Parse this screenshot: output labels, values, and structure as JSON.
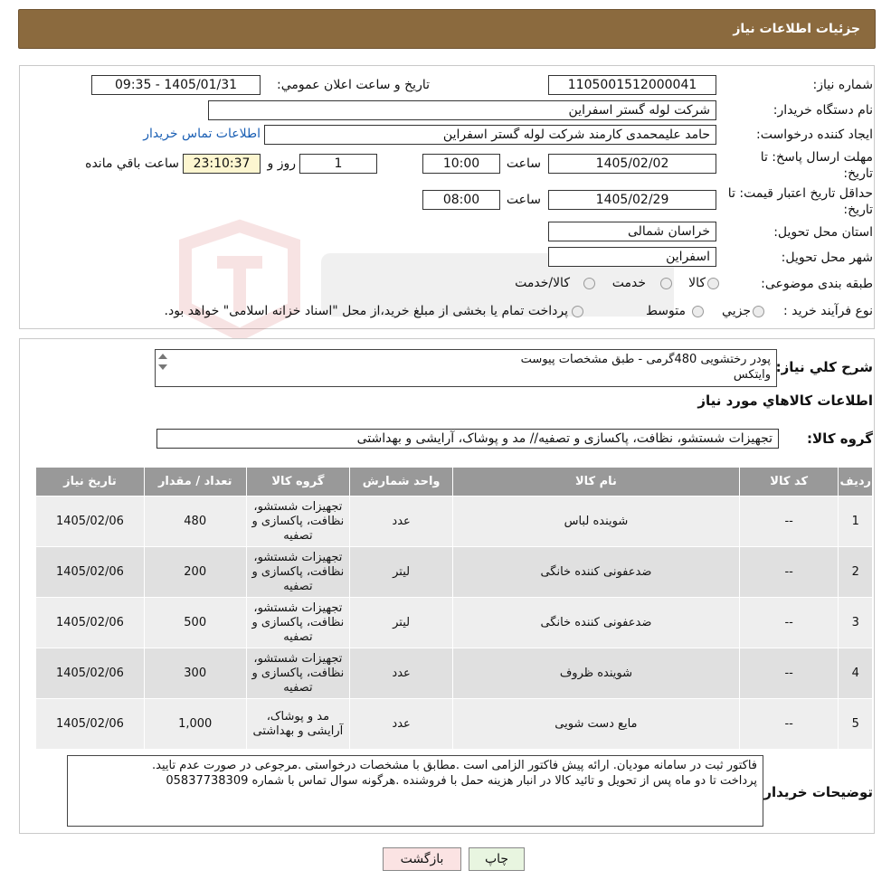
{
  "header": {
    "title": "جزئیات اطلاعات نیاز"
  },
  "info": {
    "need_number_label": "شماره نیاز:",
    "need_number": "1105001512000041",
    "announce_label": "تاریخ و ساعت اعلان عمومي:",
    "announce_value": "1405/01/31 - 09:35",
    "buyer_org_label": "نام دستگاه خریدار:",
    "buyer_org": "شرکت لوله گستر اسفراین",
    "creator_label": "ایجاد کننده درخواست:",
    "creator": "حامد علیمحمدی کارمند شرکت لوله گستر اسفراین",
    "contact_link": "اطلاعات تماس خریدار",
    "reply_deadline_label_1": "مهلت ارسال پاسخ: تا",
    "reply_deadline_label_2": "تاریخ:",
    "reply_date": "1405/02/02",
    "time_label": "ساعت",
    "reply_time": "10:00",
    "reply_days": "1",
    "days_label": "روز و",
    "remaining_time": "23:10:37",
    "remaining_label": "ساعت باقي مانده",
    "price_validity_label_1": "حداقل تاریخ اعتبار قیمت: تا",
    "price_validity_label_2": "تاریخ:",
    "price_date": "1405/02/29",
    "price_time": "08:00",
    "province_label": "استان محل تحویل:",
    "province": "خراسان شمالی",
    "city_label": "شهر محل تحویل:",
    "city": "اسفراین",
    "category_label": "طبقه بندی موضوعی:",
    "category_options": [
      "کالا",
      "خدمت",
      "کالا/خدمت"
    ],
    "process_label": "نوع فرآیند خرید :",
    "process_options": [
      "جزیي",
      "متوسط"
    ],
    "process_note": "پرداخت تمام یا بخشی از مبلغ خرید،از محل \"اسناد خزانه اسلامی\" خواهد بود."
  },
  "details": {
    "summary_label": "شرح کلي نیاز:",
    "summary_line1": "پودر رختشویی 480گرمی - طبق مشخصات پیوست",
    "summary_line2": "وایتکس",
    "goods_info_title": "اطلاعات کالاهاي مورد نیاز",
    "goods_group_label": "گروه کالا:",
    "goods_group": "تجهیزات شستشو، نظافت، پاکسازی و تصفیه// مد و پوشاک، آرایشی و بهداشتی"
  },
  "table": {
    "headers": [
      "ردیف",
      "کد کالا",
      "نام کالا",
      "واحد شمارش",
      "گروه کالا",
      "تعداد / مقدار",
      "تاریخ نیاز"
    ],
    "rows": [
      {
        "row": "1",
        "code": "--",
        "name": "شوینده لباس",
        "unit": "عدد",
        "group": "تجهیزات شستشو، نظافت، پاکسازی و تصفیه",
        "qty": "480",
        "date": "1405/02/06"
      },
      {
        "row": "2",
        "code": "--",
        "name": "ضدعفونی کننده خانگی",
        "unit": "لیتر",
        "group": "تجهیزات شستشو، نظافت، پاکسازی و تصفیه",
        "qty": "200",
        "date": "1405/02/06"
      },
      {
        "row": "3",
        "code": "--",
        "name": "ضدعفونی کننده خانگی",
        "unit": "لیتر",
        "group": "تجهیزات شستشو، نظافت، پاکسازی و تصفیه",
        "qty": "500",
        "date": "1405/02/06"
      },
      {
        "row": "4",
        "code": "--",
        "name": "شوینده ظروف",
        "unit": "عدد",
        "group": "تجهیزات شستشو، نظافت، پاکسازی و تصفیه",
        "qty": "300",
        "date": "1405/02/06"
      },
      {
        "row": "5",
        "code": "--",
        "name": "مایع دست شویی",
        "unit": "عدد",
        "group": "مد و پوشاک، آرایشی و بهداشتی",
        "qty": "1,000",
        "date": "1405/02/06"
      }
    ]
  },
  "buyer_notes": {
    "label": "توضیحات خریدار:",
    "line1": "فاکتور ثبت در سامانه مودیان. ارائه پیش فاکتور الزامی است .مطابق با مشخصات درخواستی .مرجوعی در صورت عدم تایید.",
    "line2": "پرداخت تا دو ماه پس از تحویل و تائید کالا در انبار  هزینه حمل با فروشنده .هرگونه سوال تماس با شماره 05837738309"
  },
  "buttons": {
    "print": "چاپ",
    "back": "بازگشت"
  },
  "colors": {
    "header_bg": "#8b6a3e",
    "table_header_bg": "#999999",
    "link": "#1a5fb4",
    "back_btn_bg": "#fbe3e3",
    "print_btn_bg": "#e8f5e0"
  }
}
